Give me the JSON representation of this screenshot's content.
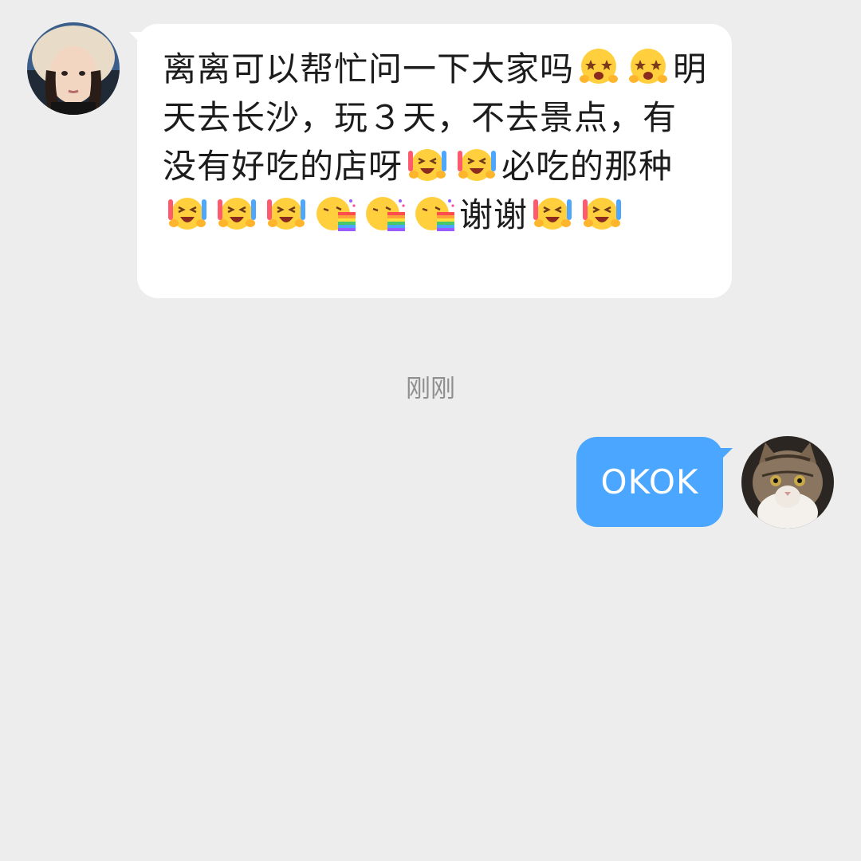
{
  "colors": {
    "background": "#ededed",
    "incoming_bubble": "#ffffff",
    "outgoing_bubble": "#4aa6ff",
    "timestamp_text": "#8f8f8f"
  },
  "incoming_message": {
    "sender_avatar": "girl-in-fur-hat-avatar",
    "segments": [
      {
        "t": "text",
        "v": "离离可以帮忙问一下大家吗"
      },
      {
        "t": "emoji",
        "v": "starry-eyed-emoji"
      },
      {
        "t": "emoji",
        "v": "starry-eyed-emoji"
      },
      {
        "t": "text",
        "v": "明天去长沙，玩３天，不去景点，有没有好吃的店呀"
      },
      {
        "t": "emoji",
        "v": "cheering-emoji"
      },
      {
        "t": "emoji",
        "v": "cheering-emoji"
      },
      {
        "t": "text",
        "v": "必吃的那种"
      },
      {
        "t": "emoji",
        "v": "cheering-emoji"
      },
      {
        "t": "emoji",
        "v": "cheering-emoji"
      },
      {
        "t": "emoji",
        "v": "cheering-emoji"
      },
      {
        "t": "emoji",
        "v": "rainbow-puke-emoji"
      },
      {
        "t": "emoji",
        "v": "rainbow-puke-emoji"
      },
      {
        "t": "emoji",
        "v": "rainbow-puke-emoji"
      },
      {
        "t": "text",
        "v": "谢谢"
      },
      {
        "t": "emoji",
        "v": "cheering-emoji"
      },
      {
        "t": "emoji",
        "v": "cheering-emoji"
      }
    ]
  },
  "timestamp": "刚刚",
  "outgoing_message": {
    "text": "OKOK",
    "sender_avatar": "tabby-cat-avatar"
  }
}
